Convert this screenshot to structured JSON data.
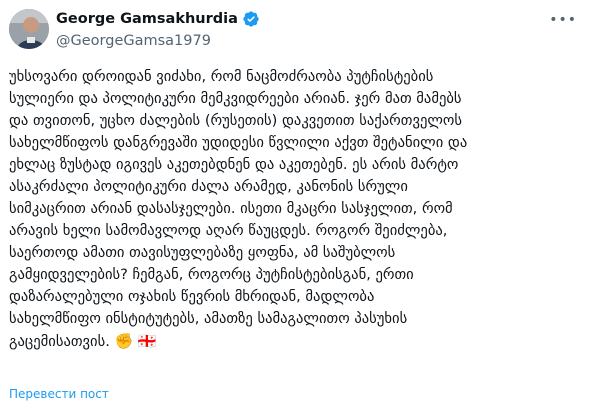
{
  "author": {
    "display_name": "George Gamsakhurdia",
    "handle": "@GeorgeGamsa1979",
    "verified": true,
    "avatar_icon": "avatar-photo",
    "more_icon": "more-options-icon"
  },
  "tweet": {
    "lines": [
      "უხსოვარი დროიდან ვიძახი, რომ ნაცმოძრაობა პუტჩისტების",
      "სულიერი და პოლიტიკური მემკვიდრეები არიან. ჯერ მათ მამებს",
      "და თვითონ, უცხო ძალების (რუსეთის) დაკვეთით საქართველოს",
      "სახელმწიფოს დანგრევაში უდიდესი წვლილი აქვთ შეტანილი და",
      "ეხლაც ზუსტად იგივეს აკეთებდნენ და აკეთებენ. ეს არის მარტო",
      "ასაკრძალი პოლიტიკური ძალა  არამედ, კანონის სრული",
      "სიმკაცრით  არიან დასასჯელები. ისეთი მკაცრი სასჯელით, რომ",
      "არავის ხელი სამომავლოდ აღარ წაუცდეს. როგორ შეიძლება,",
      "საერთოდ ამათი თავისუფლებაზე ყოფნა, ამ საშუბლოს",
      "გამყიდველების?  ჩემგან, როგორც პუტჩისტებისგან, ერთი",
      "დაზარალებული ოჯახის წევრის მხრიდან, მადლობა",
      "სახელმწიფო ინსტიტუტებს, ამათზე სამაგალითო პასუხის",
      "გაცემისათვის."
    ],
    "emojis": [
      "✊",
      "🇬🇪"
    ]
  },
  "translate_label": "Перевести пост",
  "colors": {
    "text": "#0f1419",
    "secondary": "#536471",
    "link": "#1d9bf0",
    "verified": "#1d9bf0"
  }
}
